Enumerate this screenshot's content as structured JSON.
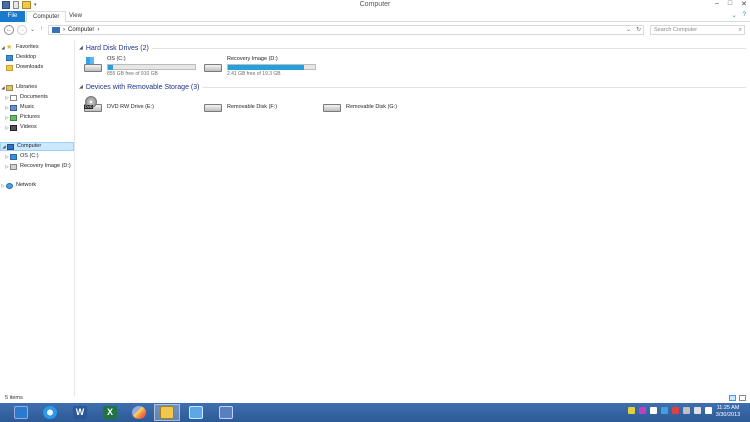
{
  "window": {
    "title": "Computer",
    "controls": [
      "–",
      "□",
      "✕"
    ]
  },
  "ribbon": {
    "file_label": "File",
    "tabs": [
      "Computer",
      "View"
    ],
    "right_glyphs": [
      "⌄",
      "?"
    ]
  },
  "address": {
    "back": "←",
    "forward": "→",
    "dropdown": "⌄",
    "up": "↑",
    "separator_before": "›",
    "path": "Computer",
    "separator_after": "›",
    "history_dropdown": "⌄",
    "refresh": "↻",
    "search_placeholder": "Search Computer",
    "search_icon": "magnifier-icon"
  },
  "nav": {
    "favorites": {
      "label": "Favorites",
      "items": [
        "Desktop",
        "Downloads"
      ]
    },
    "libraries": {
      "label": "Libraries",
      "items": [
        "Documents",
        "Music",
        "Pictures",
        "Videos"
      ]
    },
    "computer": {
      "label": "Computer",
      "items": [
        "OS (C:)",
        "Recovery Image (D:)"
      ]
    },
    "network": {
      "label": "Network"
    }
  },
  "groups": {
    "hdd": {
      "header": "Hard Disk Drives (2)",
      "drives": [
        {
          "name": "OS (C:)",
          "free": "855 GB free of 910 GB",
          "used_fraction": 0.06
        },
        {
          "name": "Recovery Image (D:)",
          "free": "2.41 GB free of 19.3 GB",
          "used_fraction": 0.875
        }
      ]
    },
    "removable": {
      "header": "Devices with Removable Storage (3)",
      "drives": [
        {
          "name": "DVD RW Drive (E:)",
          "tag": "DVD"
        },
        {
          "name": "Removable Disk (F:)"
        },
        {
          "name": "Removable Disk (G:)"
        }
      ]
    }
  },
  "status": {
    "items": "5 items"
  },
  "taskbar": {
    "apps": [
      "start-icon",
      "ie-icon",
      "word-icon",
      "excel-icon",
      "paint-icon",
      "file-explorer-icon",
      "network-icon",
      "computer-icon"
    ],
    "word_glyph": "W",
    "excel_glyph": "X",
    "clock_time": "11:25 AM",
    "clock_date": "3/30/2013",
    "colors": {
      "bar": "#3f6fb0",
      "accent": "#1979ca"
    }
  }
}
